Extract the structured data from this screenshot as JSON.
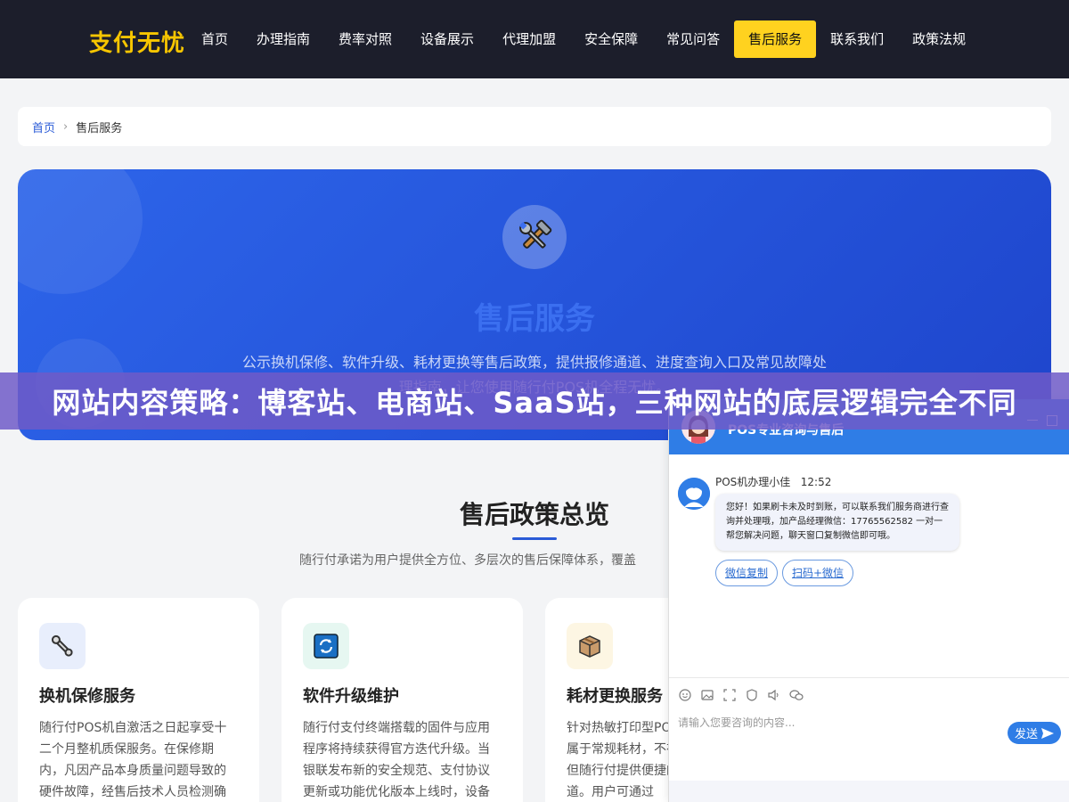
{
  "header": {
    "logo": "支付无忧",
    "nav": [
      "首页",
      "办理指南",
      "费率对照",
      "设备展示",
      "代理加盟",
      "安全保障",
      "常见问答",
      "售后服务",
      "联系我们",
      "政策法规"
    ],
    "active_index": 7
  },
  "breadcrumb": {
    "home": "首页",
    "separator": "›",
    "current": "售后服务"
  },
  "hero": {
    "icon": "tools-icon",
    "title": "售后服务",
    "desc": "公示换机保修、软件升级、耗材更换等售后政策，提供报修通道、进度查询入口及常见故障处理指南，让您使用随行付POS机全程无忧。"
  },
  "banner": {
    "text": "网站内容策略：博客站、电商站、SaaS站，三种网站的底层逻辑完全不同"
  },
  "overview": {
    "title": "售后政策总览",
    "subtitle": "随行付承诺为用户提供全方位、多层次的售后保障体系，覆盖"
  },
  "cards": [
    {
      "icon": "wrench-icon",
      "title": "换机保修服务",
      "text": "随行付POS机自激活之日起享受十二个月整机质保服务。在保修期内，凡因产品本身质量问题导致的硬件故障，经售后技术人员检测确"
    },
    {
      "icon": "refresh-icon",
      "title": "软件升级维护",
      "text": "随行付支付终端搭载的固件与应用程序将持续获得官方迭代升级。当银联发布新的安全规范、支付协议更新或功能优化版本上线时，设备"
    },
    {
      "icon": "package-icon",
      "title": "耗材更换服务",
      "text": "针对热敏打印型POS机，打印纸卷属于常规耗材，不在保修范围内，但随行付提供便捷的耗材补给通道。用户可通过"
    }
  ],
  "chat": {
    "title": "POS专业咨询与售后",
    "sender": "POS机办理小佳",
    "time": "12:52",
    "message": "您好！如果刷卡未及时到账，可以联系我们服务商进行查询并处理哦，加产品经理微信：17765562582 一对一帮您解决问题，聊天窗口复制微信即可哦。",
    "quick_replies": [
      "微信复制",
      "扫码+微信"
    ],
    "input_placeholder": "请输入您要咨询的内容...",
    "send_label": "发送",
    "tools": [
      "emoji-icon",
      "image-icon",
      "screenshot-icon",
      "evaluate-icon",
      "voice-icon",
      "wechat-icon"
    ]
  },
  "colors": {
    "nav_bg": "#1c1e2b",
    "brand": "#f7c600",
    "hero": "#2d65ea",
    "accent": "#2a5bd7",
    "chat_head": "#2f7de6"
  }
}
